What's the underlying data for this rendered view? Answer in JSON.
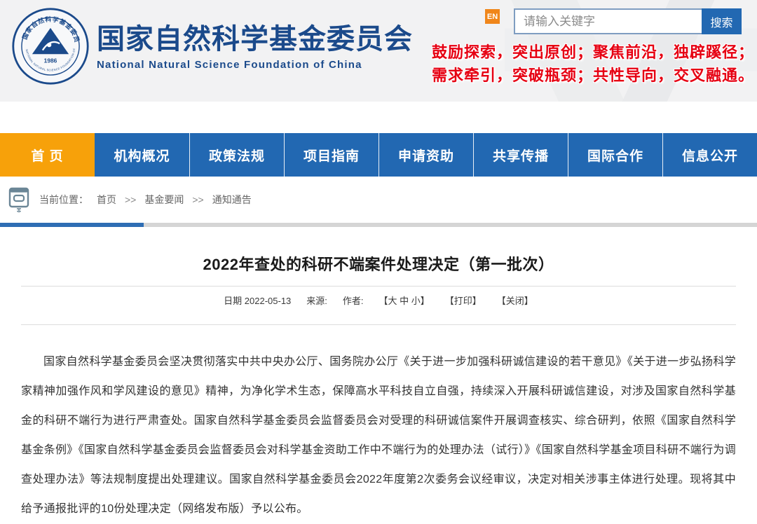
{
  "header": {
    "logo": {
      "seal_top_text": "国家自然科学基金委员会",
      "seal_year": "1986",
      "seal_bottom_text": "NATIONAL NATURAL SCIENCE FOUNDATION OF CHINA"
    },
    "title_cn": "国家自然科学基金委员会",
    "title_en": "National Natural Science Foundation of China",
    "en_badge_label": "EN",
    "search": {
      "placeholder": "请输入关键字",
      "button_label": "搜索"
    },
    "slogan_line1": "鼓励探索，突出原创；聚焦前沿，独辟蹊径；",
    "slogan_line2": "需求牵引，突破瓶颈；共性导向，交叉融通。"
  },
  "nav": {
    "items": [
      {
        "label": "首  页",
        "active": true
      },
      {
        "label": "机构概况",
        "active": false
      },
      {
        "label": "政策法规",
        "active": false
      },
      {
        "label": "项目指南",
        "active": false
      },
      {
        "label": "申请资助",
        "active": false
      },
      {
        "label": "共享传播",
        "active": false
      },
      {
        "label": "国际合作",
        "active": false
      },
      {
        "label": "信息公开",
        "active": false
      }
    ]
  },
  "breadcrumb": {
    "location_label": "当前位置：",
    "separator": ">>",
    "items": [
      "首页",
      "基金要闻",
      "通知通告"
    ]
  },
  "article": {
    "title": "2022年查处的科研不端案件处理决定（第一批次）",
    "meta": {
      "date": "日期 2022-05-13",
      "source_label": "来源:",
      "author_label": "作者:",
      "font_size_control": "【大 中 小】",
      "print_control": "【打印】",
      "close_control": "【关闭】"
    },
    "body": "国家自然科学基金委员会坚决贯彻落实中共中央办公厅、国务院办公厅《关于进一步加强科研诚信建设的若干意见》《关于进一步弘扬科学家精神加强作风和学风建设的意见》精神，为净化学术生态，保障高水平科技自立自强，持续深入开展科研诚信建设，对涉及国家自然科学基金的科研不端行为进行严肃查处。国家自然科学基金委员会监督委员会对受理的科研诚信案件开展调查核实、综合研判，依照《国家自然科学基金条例》《国家自然科学基金委员会监督委员会对科学基金资助工作中不端行为的处理办法（试行）》《国家自然科学基金项目科研不端行为调查处理办法》等法规制度提出处理建议。国家自然科学基金委员会2022年度第2次委务会议经审议，决定对相关涉事主体进行处理。现将其中给予通报批评的10份处理决定（网络发布版）予以公布。"
  },
  "colors": {
    "brand_blue": "#1b4a8b",
    "nav_blue": "#2268b2",
    "nav_active_orange": "#f7a10a",
    "en_badge_orange": "#f0861a",
    "slogan_red": "#e60012",
    "divider_blue": "#2e6db4",
    "divider_gray": "#d5d5d5",
    "header_bg": "#f2f2f3",
    "body_text": "#333333"
  }
}
